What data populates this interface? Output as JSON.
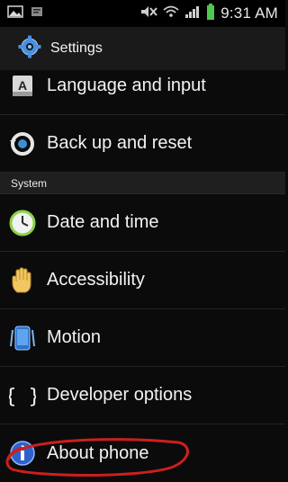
{
  "status_bar": {
    "time": "9:31 AM"
  },
  "header": {
    "title": "Settings"
  },
  "settings_list": {
    "items_before_section": [
      {
        "label": "Language and input",
        "icon": "language-icon"
      },
      {
        "label": "Back up and reset",
        "icon": "backup-reset-icon"
      }
    ],
    "section_title": "System",
    "items_after_section": [
      {
        "label": "Date and time",
        "icon": "clock-icon"
      },
      {
        "label": "Accessibility",
        "icon": "hand-icon"
      },
      {
        "label": "Motion",
        "icon": "phone-motion-icon"
      },
      {
        "label": "Developer options",
        "icon": "braces-icon"
      },
      {
        "label": "About phone",
        "icon": "info-icon"
      }
    ]
  },
  "annotation": {
    "highlight_color": "#cc1f1f",
    "highlighted_item": "About phone"
  }
}
